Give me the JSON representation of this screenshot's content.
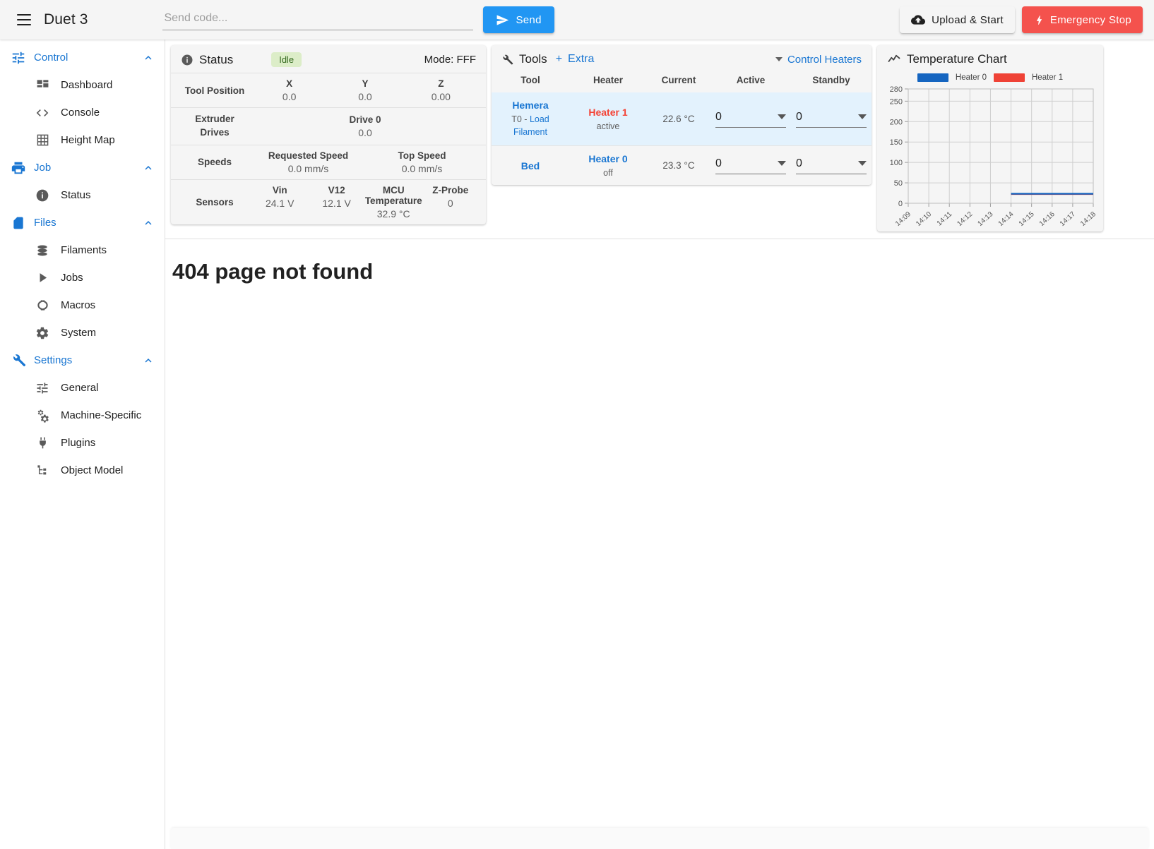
{
  "topbar": {
    "menu_icon": "hamburger-icon",
    "title": "Duet 3",
    "code_placeholder": "Send code...",
    "code_value": "",
    "send_label": "Send",
    "send_icon": "send-icon",
    "upload_label": "Upload & Start",
    "upload_icon": "cloud-upload-icon",
    "estop_label": "Emergency Stop",
    "estop_icon": "lightning-bolt-icon",
    "colors": {
      "primary": "#2196f3",
      "danger": "#f4524d"
    }
  },
  "sidebar": {
    "groups": [
      {
        "label": "Control",
        "icon": "sliders-icon",
        "expanded": true,
        "items": [
          {
            "label": "Dashboard",
            "icon": "dashboard-icon"
          },
          {
            "label": "Console",
            "icon": "code-brackets-icon"
          },
          {
            "label": "Height Map",
            "icon": "grid-icon"
          }
        ]
      },
      {
        "label": "Job",
        "icon": "printer-icon",
        "expanded": true,
        "items": [
          {
            "label": "Status",
            "icon": "info-circle-icon"
          }
        ]
      },
      {
        "label": "Files",
        "icon": "sd-card-icon",
        "expanded": true,
        "items": [
          {
            "label": "Filaments",
            "icon": "database-icon"
          },
          {
            "label": "Jobs",
            "icon": "play-icon"
          },
          {
            "label": "Macros",
            "icon": "macro-icon"
          },
          {
            "label": "System",
            "icon": "gear-icon"
          }
        ]
      },
      {
        "label": "Settings",
        "icon": "wrench-icon",
        "expanded": true,
        "items": [
          {
            "label": "General",
            "icon": "sliders-icon"
          },
          {
            "label": "Machine-Specific",
            "icon": "gears-icon"
          },
          {
            "label": "Plugins",
            "icon": "plug-icon"
          },
          {
            "label": "Object Model",
            "icon": "tree-icon"
          }
        ]
      }
    ]
  },
  "status_card": {
    "icon": "info-circle-icon",
    "title": "Status",
    "badge": "Idle",
    "badge_color": "#dcedc8",
    "mode": "Mode: FFF",
    "rows": [
      {
        "label": "Tool Position",
        "cells": [
          {
            "head": "X",
            "value": "0.0"
          },
          {
            "head": "Y",
            "value": "0.0"
          },
          {
            "head": "Z",
            "value": "0.00"
          }
        ]
      },
      {
        "label": "Extruder Drives",
        "label_line1": "Extruder",
        "label_line2": "Drives",
        "cells": [
          {
            "head": "Drive 0",
            "value": "0.0"
          }
        ]
      },
      {
        "label": "Speeds",
        "cells": [
          {
            "head": "Requested Speed",
            "value": "0.0 mm/s"
          },
          {
            "head": "Top Speed",
            "value": "0.0 mm/s"
          }
        ]
      },
      {
        "label": "Sensors",
        "cells": [
          {
            "head": "Vin",
            "value": "24.1 V"
          },
          {
            "head": "V12",
            "value": "12.1 V"
          },
          {
            "head": "MCU Temperature",
            "value": "32.9 °C"
          },
          {
            "head": "Z-Probe",
            "value": "0"
          }
        ]
      }
    ]
  },
  "tools_card": {
    "icon": "wrench-icon",
    "title": "Tools",
    "extra_plus": "+",
    "extra_label": "Extra",
    "control_heaters_label": "Control Heaters",
    "columns": [
      "Tool",
      "Heater",
      "Current",
      "Active",
      "Standby"
    ],
    "rows": [
      {
        "selected": true,
        "tool_name": "Hemera",
        "tool_sub_prefix": "T0 - ",
        "tool_sub_link1": "Load",
        "tool_sub_link2": "Filament",
        "heater_name": "Heater 1",
        "heater_color": "red",
        "heater_state": "active",
        "current": "22.6 °C",
        "active": "0",
        "standby": "0"
      },
      {
        "selected": false,
        "tool_name": "Bed",
        "tool_sub_prefix": "",
        "tool_sub_link1": "",
        "tool_sub_link2": "",
        "heater_name": "Heater 0",
        "heater_color": "blue",
        "heater_state": "off",
        "current": "23.3 °C",
        "active": "0",
        "standby": "0"
      }
    ]
  },
  "chart_card": {
    "icon": "trend-line-icon",
    "title": "Temperature Chart"
  },
  "chart_data": {
    "type": "line",
    "title": "Temperature Chart",
    "xlabel": "",
    "ylabel": "",
    "grid": true,
    "legend_position": "top",
    "ylim": [
      0,
      280
    ],
    "yticks": [
      0,
      50,
      100,
      150,
      200,
      250,
      280
    ],
    "x": [
      "14:09",
      "14:10",
      "14:11",
      "14:12",
      "14:13",
      "14:14",
      "14:15",
      "14:16",
      "14:17",
      "14:18"
    ],
    "series": [
      {
        "name": "Heater 0",
        "color": "#1565c0",
        "values": [
          null,
          null,
          null,
          null,
          null,
          23.3,
          23.3,
          23.3,
          23.3,
          23.3
        ]
      },
      {
        "name": "Heater 1",
        "color": "#ef4236",
        "values": [
          null,
          null,
          null,
          null,
          null,
          22.6,
          22.6,
          22.6,
          22.6,
          22.6
        ]
      }
    ]
  },
  "main": {
    "not_found": "404 page not found"
  }
}
